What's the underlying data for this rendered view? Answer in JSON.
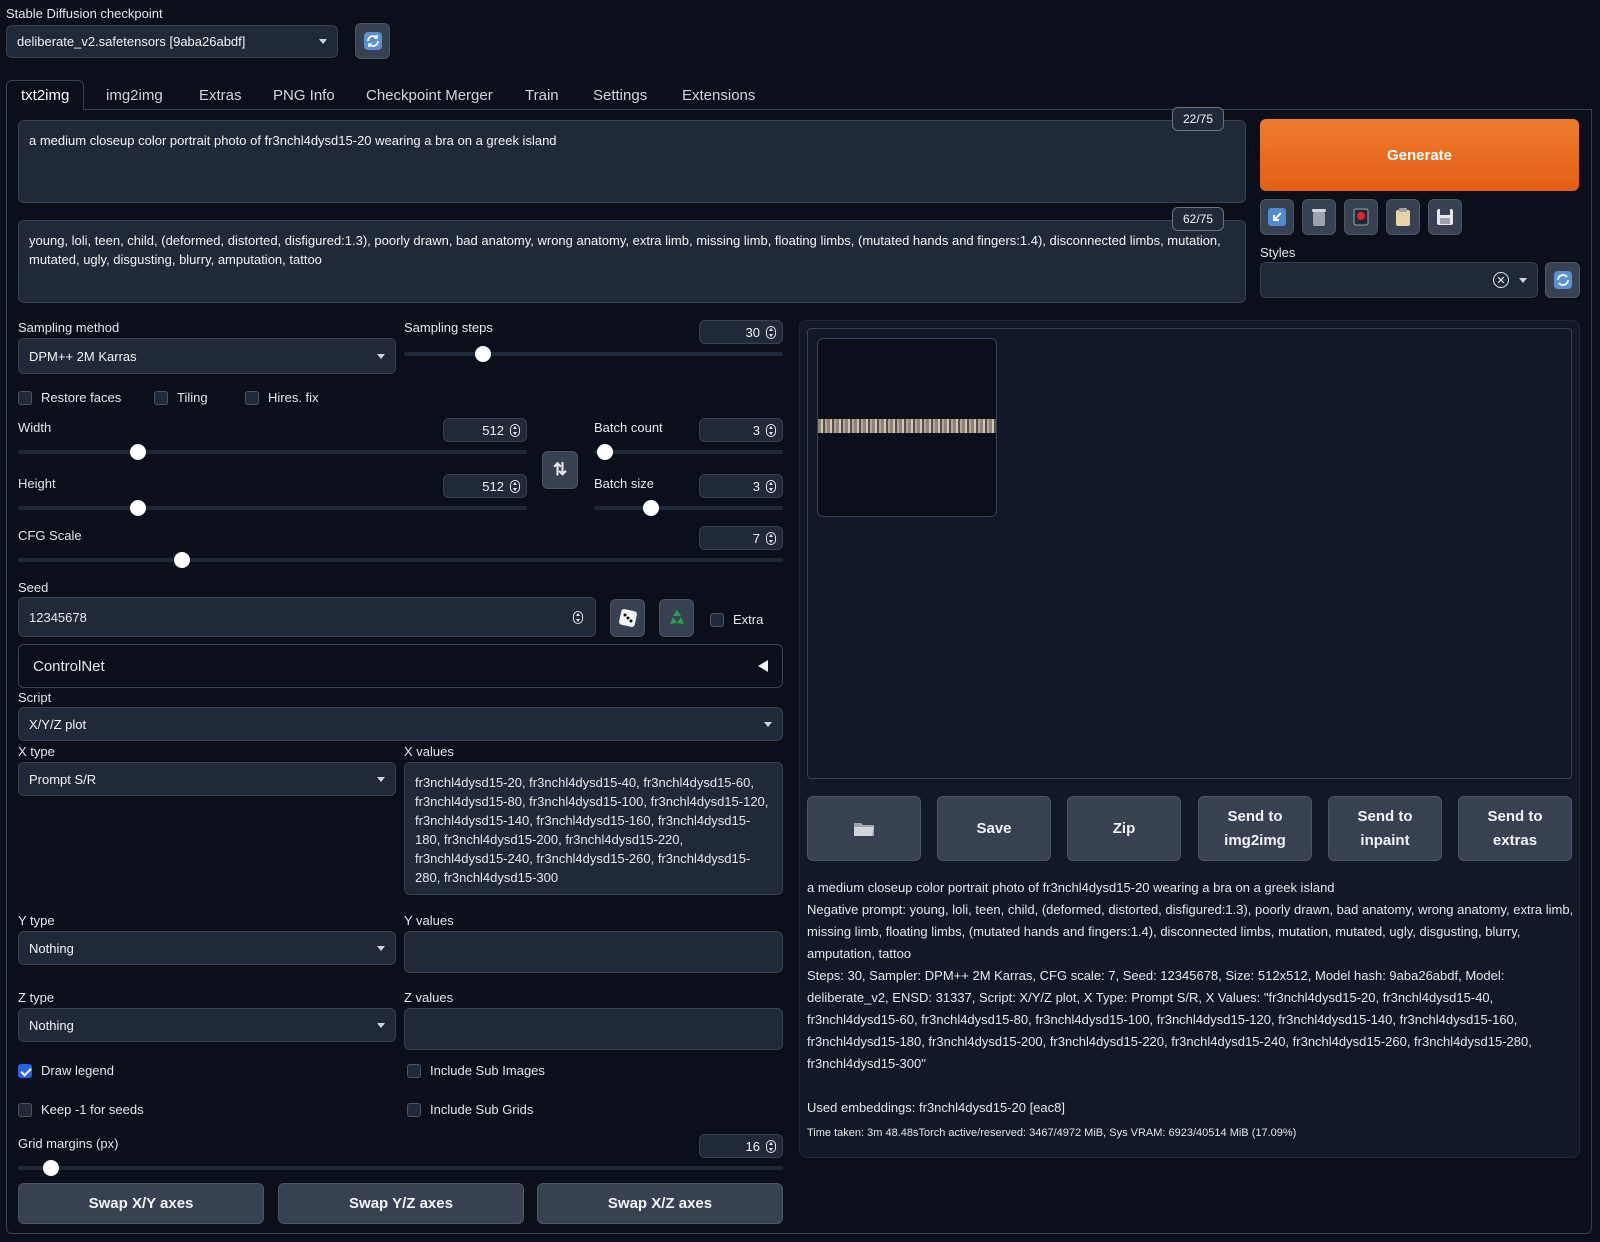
{
  "checkpoint": {
    "label": "Stable Diffusion checkpoint",
    "value": "deliberate_v2.safetensors [9aba26abdf]"
  },
  "tabs": [
    "txt2img",
    "img2img",
    "Extras",
    "PNG Info",
    "Checkpoint Merger",
    "Train",
    "Settings",
    "Extensions"
  ],
  "prompt": {
    "text": "a medium closeup color portrait photo of fr3nchl4dysd15-20 wearing a bra on a greek island",
    "counter": "22/75"
  },
  "negative_prompt": {
    "text": "young, loli, teen, child, (deformed, distorted, disfigured:1.3), poorly drawn, bad anatomy, wrong anatomy, extra limb, missing limb, floating limbs, (mutated hands and fingers:1.4), disconnected limbs, mutation, mutated, ugly, disgusting, blurry, amputation, tattoo",
    "counter": "62/75"
  },
  "generate": {
    "label": "Generate",
    "color": "#ea6a1f"
  },
  "styles": {
    "label": "Styles",
    "value": ""
  },
  "sampling": {
    "method_label": "Sampling method",
    "method": "DPM++ 2M Karras",
    "steps_label": "Sampling steps",
    "steps": "30"
  },
  "options": {
    "restore_faces": "Restore faces",
    "tiling": "Tiling",
    "hires_fix": "Hires. fix"
  },
  "dims": {
    "width_label": "Width",
    "width": "512",
    "height_label": "Height",
    "height": "512"
  },
  "batch": {
    "count_label": "Batch count",
    "count": "3",
    "size_label": "Batch size",
    "size": "3"
  },
  "cfg": {
    "label": "CFG Scale",
    "value": "7"
  },
  "seed": {
    "label": "Seed",
    "value": "12345678",
    "extra_label": "Extra"
  },
  "controlnet": {
    "label": "ControlNet"
  },
  "script": {
    "label": "Script",
    "value": "X/Y/Z plot",
    "x_type_label": "X type",
    "x_type": "Prompt S/R",
    "x_values_label": "X values",
    "x_values": "fr3nchl4dysd15-20, fr3nchl4dysd15-40, fr3nchl4dysd15-60, fr3nchl4dysd15-80, fr3nchl4dysd15-100, fr3nchl4dysd15-120, fr3nchl4dysd15-140, fr3nchl4dysd15-160, fr3nchl4dysd15-180, fr3nchl4dysd15-200, fr3nchl4dysd15-220, fr3nchl4dysd15-240, fr3nchl4dysd15-260, fr3nchl4dysd15-280, fr3nchl4dysd15-300",
    "y_type_label": "Y type",
    "y_type": "Nothing",
    "y_values_label": "Y values",
    "y_values": "",
    "z_type_label": "Z type",
    "z_type": "Nothing",
    "z_values_label": "Z values",
    "z_values": "",
    "draw_legend": "Draw legend",
    "include_sub_images": "Include Sub Images",
    "keep_seeds": "Keep -1 for seeds",
    "include_sub_grids": "Include Sub Grids",
    "grid_margins_label": "Grid margins (px)",
    "grid_margins": "16",
    "swap_xy": "Swap X/Y axes",
    "swap_yz": "Swap Y/Z axes",
    "swap_xz": "Swap X/Z axes"
  },
  "output_buttons": {
    "save": "Save",
    "zip": "Zip",
    "img2img": [
      "Send to",
      "img2img"
    ],
    "inpaint": [
      "Send to",
      "inpaint"
    ],
    "extras": [
      "Send to",
      "extras"
    ]
  },
  "output_info": {
    "prompt": "a medium closeup color portrait photo of fr3nchl4dysd15-20 wearing a bra on a greek island",
    "negative": "Negative prompt: young, loli, teen, child, (deformed, distorted, disfigured:1.3), poorly drawn, bad anatomy, wrong anatomy, extra limb, missing limb, floating limbs, (mutated hands and fingers:1.4), disconnected limbs, mutation, mutated, ugly, disgusting, blurry, amputation, tattoo",
    "params": "Steps: 30, Sampler: DPM++ 2M Karras, CFG scale: 7, Seed: 12345678, Size: 512x512, Model hash: 9aba26abdf, Model: deliberate_v2, ENSD: 31337, Script: X/Y/Z plot, X Type: Prompt S/R, X Values: \"fr3nchl4dysd15-20, fr3nchl4dysd15-40, fr3nchl4dysd15-60, fr3nchl4dysd15-80, fr3nchl4dysd15-100, fr3nchl4dysd15-120, fr3nchl4dysd15-140, fr3nchl4dysd15-160, fr3nchl4dysd15-180, fr3nchl4dysd15-200, fr3nchl4dysd15-220, fr3nchl4dysd15-240, fr3nchl4dysd15-260, fr3nchl4dysd15-280, fr3nchl4dysd15-300\"",
    "embeddings": "Used embeddings: fr3nchl4dysd15-20 [eac8]",
    "time": "Time taken: 3m 48.48sTorch active/reserved: 3467/4972 MiB, Sys VRAM: 6923/40514 MiB (17.09%)"
  }
}
